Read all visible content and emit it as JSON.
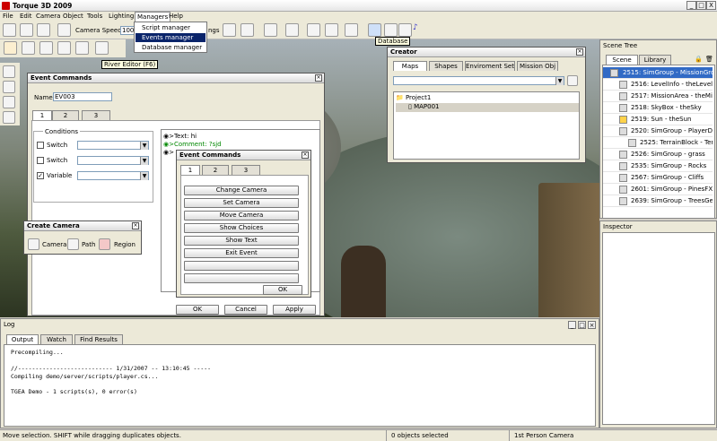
{
  "app": {
    "title": "Torque 3D 2009"
  },
  "window_controls": [
    "_",
    "□",
    "X"
  ],
  "menubar": {
    "items": [
      "File",
      "Edit",
      "Camera",
      "Object",
      "Tools",
      "Lighting",
      "Managers",
      "Help"
    ]
  },
  "managers_menu": {
    "items": [
      "Script manager",
      "Events manager",
      "Database manager"
    ],
    "selected": "Events manager"
  },
  "toolbar": {
    "camera_speed_label": "Camera Speed",
    "camera_speed_value": "100",
    "settings_fragment": "ngs",
    "database_tooltip": "Database"
  },
  "river_editor_tooltip": "River Editor (F6)",
  "event_commands": {
    "title": "Event Commands",
    "name_label": "Name:",
    "name_value": "EV003",
    "tabs": [
      "1",
      "2",
      "3"
    ],
    "conditions_label": "Conditions",
    "conditions": [
      {
        "label": "Switch",
        "checked": false
      },
      {
        "label": "Switch",
        "checked": false
      },
      {
        "label": "Variable",
        "checked": true
      }
    ],
    "script_lines": [
      ">Text: hi",
      ">Comment: ?sjd",
      ">"
    ],
    "buttons": [
      "OK",
      "Cancel",
      "Apply"
    ]
  },
  "event_commands_sub": {
    "title": "Event Commands",
    "tabs": [
      "1",
      "2",
      "3"
    ],
    "commands": [
      "Change Camera",
      "Set Camera",
      "Move Camera",
      "Show Choices",
      "Show Text",
      "Exit Event",
      "",
      ""
    ],
    "ok": "OK"
  },
  "create_camera": {
    "title": "Create Camera",
    "items": [
      "Camera",
      "Path",
      "Region"
    ]
  },
  "creator": {
    "title": "Creator",
    "tabs": [
      "Maps",
      "Shapes",
      "Enviroment Set",
      "Mission Obj"
    ],
    "tree": [
      {
        "label": "Project1",
        "level": 0
      },
      {
        "label": "MAP001",
        "level": 1
      }
    ]
  },
  "scene_tree": {
    "title": "Scene Tree",
    "tabs": [
      "Scene",
      "Library"
    ],
    "items": [
      {
        "label": "2515: SimGroup - MissionGrou",
        "selected": true,
        "indent": 0,
        "icon": "folder-icon"
      },
      {
        "label": "2516: LevelInfo - theLevelIn",
        "selected": false,
        "indent": 1,
        "icon": "info-icon"
      },
      {
        "label": "2517: MissionArea - theMis",
        "selected": false,
        "indent": 1,
        "icon": "area-icon"
      },
      {
        "label": "2518: SkyBox - theSky",
        "selected": false,
        "indent": 1,
        "icon": "sky-icon"
      },
      {
        "label": "2519: Sun - theSun",
        "selected": false,
        "indent": 1,
        "icon": "sun-icon"
      },
      {
        "label": "2520: SimGroup - PlayerDr",
        "selected": false,
        "indent": 1,
        "icon": "folder-icon"
      },
      {
        "label": "2525: TerrainBlock - Ter",
        "selected": false,
        "indent": 2,
        "icon": "terrain-icon"
      },
      {
        "label": "2526: SimGroup - grass",
        "selected": false,
        "indent": 1,
        "icon": "folder-icon"
      },
      {
        "label": "2535: SimGroup - Rocks",
        "selected": false,
        "indent": 1,
        "icon": "folder-icon"
      },
      {
        "label": "2567: SimGroup - Cliffs",
        "selected": false,
        "indent": 1,
        "icon": "folder-icon"
      },
      {
        "label": "2601: SimGroup - PinesFX",
        "selected": false,
        "indent": 1,
        "icon": "folder-icon"
      },
      {
        "label": "2639: SimGroup - TreesGe",
        "selected": false,
        "indent": 1,
        "icon": "folder-icon"
      }
    ]
  },
  "inspector": {
    "title": "Inspector"
  },
  "log": {
    "title": "Log",
    "tabs": [
      "Output",
      "Watch",
      "Find Results"
    ],
    "lines": [
      "Precompiling...",
      "",
      "//--------------------------- 1/31/2007 -- 13:10:45 -----",
      "Compiling demo/server/scripts/player.cs...",
      "",
      "TGEA Demo - 1 scripts(s), 0 error(s)"
    ]
  },
  "status": {
    "message": "Move selection.  SHIFT while dragging duplicates objects.",
    "selection": "0 objects selected",
    "camera": "1st Person Camera"
  },
  "colors": {
    "selection": "#0a246a",
    "accent_blue": "#316ac5",
    "panel": "#ece9d8"
  }
}
